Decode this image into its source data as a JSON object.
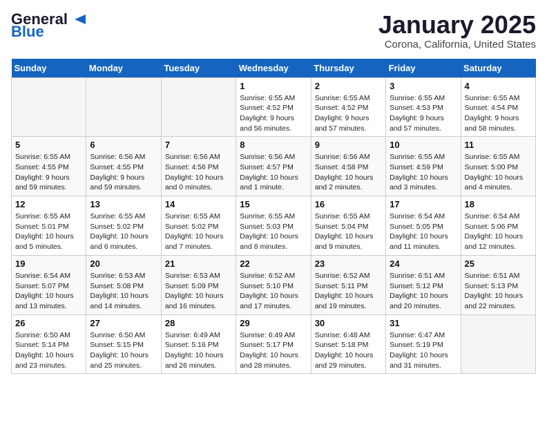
{
  "header": {
    "logo_line1": "General",
    "logo_line2": "Blue",
    "title": "January 2025",
    "subtitle": "Corona, California, United States"
  },
  "weekdays": [
    "Sunday",
    "Monday",
    "Tuesday",
    "Wednesday",
    "Thursday",
    "Friday",
    "Saturday"
  ],
  "weeks": [
    [
      {
        "day": "",
        "info": ""
      },
      {
        "day": "",
        "info": ""
      },
      {
        "day": "",
        "info": ""
      },
      {
        "day": "1",
        "info": "Sunrise: 6:55 AM\nSunset: 4:52 PM\nDaylight: 9 hours and 56 minutes."
      },
      {
        "day": "2",
        "info": "Sunrise: 6:55 AM\nSunset: 4:52 PM\nDaylight: 9 hours and 57 minutes."
      },
      {
        "day": "3",
        "info": "Sunrise: 6:55 AM\nSunset: 4:53 PM\nDaylight: 9 hours and 57 minutes."
      },
      {
        "day": "4",
        "info": "Sunrise: 6:55 AM\nSunset: 4:54 PM\nDaylight: 9 hours and 58 minutes."
      }
    ],
    [
      {
        "day": "5",
        "info": "Sunrise: 6:55 AM\nSunset: 4:55 PM\nDaylight: 9 hours and 59 minutes."
      },
      {
        "day": "6",
        "info": "Sunrise: 6:56 AM\nSunset: 4:55 PM\nDaylight: 9 hours and 59 minutes."
      },
      {
        "day": "7",
        "info": "Sunrise: 6:56 AM\nSunset: 4:56 PM\nDaylight: 10 hours and 0 minutes."
      },
      {
        "day": "8",
        "info": "Sunrise: 6:56 AM\nSunset: 4:57 PM\nDaylight: 10 hours and 1 minute."
      },
      {
        "day": "9",
        "info": "Sunrise: 6:56 AM\nSunset: 4:58 PM\nDaylight: 10 hours and 2 minutes."
      },
      {
        "day": "10",
        "info": "Sunrise: 6:55 AM\nSunset: 4:59 PM\nDaylight: 10 hours and 3 minutes."
      },
      {
        "day": "11",
        "info": "Sunrise: 6:55 AM\nSunset: 5:00 PM\nDaylight: 10 hours and 4 minutes."
      }
    ],
    [
      {
        "day": "12",
        "info": "Sunrise: 6:55 AM\nSunset: 5:01 PM\nDaylight: 10 hours and 5 minutes."
      },
      {
        "day": "13",
        "info": "Sunrise: 6:55 AM\nSunset: 5:02 PM\nDaylight: 10 hours and 6 minutes."
      },
      {
        "day": "14",
        "info": "Sunrise: 6:55 AM\nSunset: 5:02 PM\nDaylight: 10 hours and 7 minutes."
      },
      {
        "day": "15",
        "info": "Sunrise: 6:55 AM\nSunset: 5:03 PM\nDaylight: 10 hours and 8 minutes."
      },
      {
        "day": "16",
        "info": "Sunrise: 6:55 AM\nSunset: 5:04 PM\nDaylight: 10 hours and 9 minutes."
      },
      {
        "day": "17",
        "info": "Sunrise: 6:54 AM\nSunset: 5:05 PM\nDaylight: 10 hours and 11 minutes."
      },
      {
        "day": "18",
        "info": "Sunrise: 6:54 AM\nSunset: 5:06 PM\nDaylight: 10 hours and 12 minutes."
      }
    ],
    [
      {
        "day": "19",
        "info": "Sunrise: 6:54 AM\nSunset: 5:07 PM\nDaylight: 10 hours and 13 minutes."
      },
      {
        "day": "20",
        "info": "Sunrise: 6:53 AM\nSunset: 5:08 PM\nDaylight: 10 hours and 14 minutes."
      },
      {
        "day": "21",
        "info": "Sunrise: 6:53 AM\nSunset: 5:09 PM\nDaylight: 10 hours and 16 minutes."
      },
      {
        "day": "22",
        "info": "Sunrise: 6:52 AM\nSunset: 5:10 PM\nDaylight: 10 hours and 17 minutes."
      },
      {
        "day": "23",
        "info": "Sunrise: 6:52 AM\nSunset: 5:11 PM\nDaylight: 10 hours and 19 minutes."
      },
      {
        "day": "24",
        "info": "Sunrise: 6:51 AM\nSunset: 5:12 PM\nDaylight: 10 hours and 20 minutes."
      },
      {
        "day": "25",
        "info": "Sunrise: 6:51 AM\nSunset: 5:13 PM\nDaylight: 10 hours and 22 minutes."
      }
    ],
    [
      {
        "day": "26",
        "info": "Sunrise: 6:50 AM\nSunset: 5:14 PM\nDaylight: 10 hours and 23 minutes."
      },
      {
        "day": "27",
        "info": "Sunrise: 6:50 AM\nSunset: 5:15 PM\nDaylight: 10 hours and 25 minutes."
      },
      {
        "day": "28",
        "info": "Sunrise: 6:49 AM\nSunset: 5:16 PM\nDaylight: 10 hours and 26 minutes."
      },
      {
        "day": "29",
        "info": "Sunrise: 6:49 AM\nSunset: 5:17 PM\nDaylight: 10 hours and 28 minutes."
      },
      {
        "day": "30",
        "info": "Sunrise: 6:48 AM\nSunset: 5:18 PM\nDaylight: 10 hours and 29 minutes."
      },
      {
        "day": "31",
        "info": "Sunrise: 6:47 AM\nSunset: 5:19 PM\nDaylight: 10 hours and 31 minutes."
      },
      {
        "day": "",
        "info": ""
      }
    ]
  ]
}
